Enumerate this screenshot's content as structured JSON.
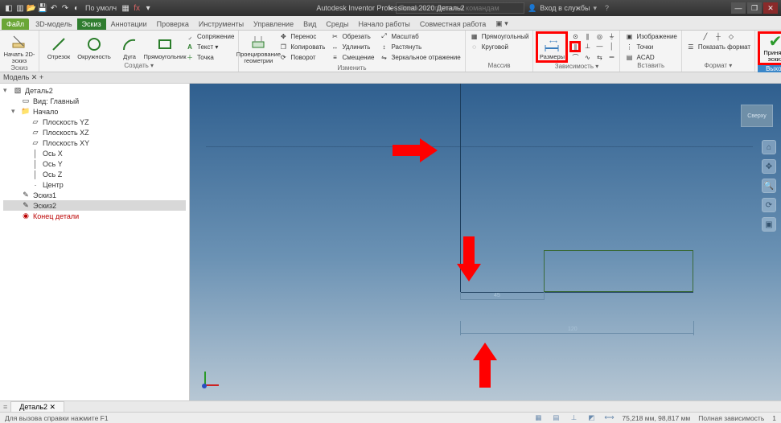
{
  "app": {
    "title_center": "Autodesk Inventor Professional 2020   Деталь2",
    "qat_style_label": "По умолч",
    "search_placeholder": "Поиск по справке и командам",
    "signin_label": "Вход в службы",
    "win_min": "—",
    "win_max": "❐",
    "win_close": "✕"
  },
  "tabs": {
    "file": "Файл",
    "items": [
      "3D-модель",
      "Эскиз",
      "Аннотации",
      "Проверка",
      "Инструменты",
      "Управление",
      "Вид",
      "Среды",
      "Начало работы",
      "Совместная работа"
    ],
    "active_index": 1
  },
  "ribbon": {
    "panels": [
      {
        "title": "Эскиз",
        "big": [
          {
            "name": "start-2d-sketch",
            "label": "Начать\n2D-эскиз",
            "icon": "pencil"
          }
        ]
      },
      {
        "title": "Создать ▾",
        "big": [
          {
            "name": "line",
            "label": "Отрезок",
            "icon": "line"
          },
          {
            "name": "circle",
            "label": "Окружность",
            "icon": "circle"
          },
          {
            "name": "arc",
            "label": "Дуга",
            "icon": "arc"
          },
          {
            "name": "rect",
            "label": "Прямоугольник",
            "icon": "rect"
          }
        ],
        "col": [
          {
            "name": "fillet",
            "label": "Сопряжение",
            "icon": "fillet"
          },
          {
            "name": "text",
            "label": "Текст ▾",
            "icon": "text"
          },
          {
            "name": "point",
            "label": "Точка",
            "icon": "point"
          }
        ]
      },
      {
        "title": "Изменить",
        "big": [
          {
            "name": "project-geometry",
            "label": "Проецирование\nгеометрии",
            "icon": "proj"
          }
        ],
        "cols": [
          [
            {
              "name": "move",
              "label": "Перенос",
              "icon": "move"
            },
            {
              "name": "copy",
              "label": "Копировать",
              "icon": "copy"
            },
            {
              "name": "rotate",
              "label": "Поворот",
              "icon": "rotate"
            }
          ],
          [
            {
              "name": "trim",
              "label": "Обрезать",
              "icon": "trim"
            },
            {
              "name": "extend",
              "label": "Удлинить",
              "icon": "extend"
            },
            {
              "name": "offset",
              "label": "Смещение",
              "icon": "offset"
            }
          ],
          [
            {
              "name": "scale",
              "label": "Масштаб",
              "icon": "scale"
            },
            {
              "name": "stretch",
              "label": "Растянуть",
              "icon": "stretch"
            },
            {
              "name": "mirror",
              "label": "Зеркальное отражение",
              "icon": "mirror"
            }
          ]
        ]
      },
      {
        "title": "Массив",
        "col": [
          {
            "name": "pattern-rect",
            "label": "Прямоугольный",
            "icon": "prect"
          },
          {
            "name": "pattern-circ",
            "label": "Круговой",
            "icon": "pcirc"
          }
        ]
      },
      {
        "title": "Зависимость ▾",
        "big": [
          {
            "name": "dimension",
            "label": "Размеры",
            "icon": "dim",
            "highlight": true
          }
        ],
        "grid": true,
        "grid_hl_index": 4
      },
      {
        "title": "Вставить",
        "col": [
          {
            "name": "image",
            "label": "Изображение",
            "icon": "img"
          },
          {
            "name": "points-import",
            "label": "Точки",
            "icon": "pts"
          },
          {
            "name": "acad",
            "label": "ACAD",
            "icon": "acad"
          }
        ]
      },
      {
        "title": "Формат ▾",
        "big": [
          {
            "name": "show-format",
            "label": "Показать формат",
            "icon": "fmt"
          }
        ]
      },
      {
        "title_special": "Выход",
        "finish": {
          "name": "finish-sketch",
          "label": "Принять\nэскиз",
          "highlight": true
        }
      }
    ]
  },
  "panelbar": {
    "label": "Модель ✕  +"
  },
  "browser": {
    "items": [
      {
        "depth": 0,
        "exp": "▾",
        "icon": "part",
        "label": "Деталь2",
        "sel": false
      },
      {
        "depth": 1,
        "exp": "",
        "icon": "view",
        "label": "Вид: Главный",
        "sel": false
      },
      {
        "depth": 1,
        "exp": "▾",
        "icon": "folder",
        "label": "Начало",
        "sel": false
      },
      {
        "depth": 2,
        "exp": "",
        "icon": "plane",
        "label": "Плоскость YZ",
        "sel": false
      },
      {
        "depth": 2,
        "exp": "",
        "icon": "plane",
        "label": "Плоскость XZ",
        "sel": false
      },
      {
        "depth": 2,
        "exp": "",
        "icon": "plane",
        "label": "Плоскость XY",
        "sel": false
      },
      {
        "depth": 2,
        "exp": "",
        "icon": "axis",
        "label": "Ось X",
        "sel": false
      },
      {
        "depth": 2,
        "exp": "",
        "icon": "axis",
        "label": "Ось Y",
        "sel": false
      },
      {
        "depth": 2,
        "exp": "",
        "icon": "axis",
        "label": "Ось Z",
        "sel": false
      },
      {
        "depth": 2,
        "exp": "",
        "icon": "pt",
        "label": "Центр",
        "sel": false
      },
      {
        "depth": 1,
        "exp": "",
        "icon": "sketch",
        "label": "Эскиз1",
        "sel": false
      },
      {
        "depth": 1,
        "exp": "",
        "icon": "sketch",
        "label": "Эскиз2",
        "sel": true
      },
      {
        "depth": 1,
        "exp": "",
        "icon": "end",
        "label": "Конец детали",
        "sel": false,
        "end": true
      }
    ]
  },
  "canvas": {
    "viewcube": "Сверху",
    "dim1_text": "45",
    "dim2_text": "120"
  },
  "doctabs": {
    "tab1": "Деталь2  ✕"
  },
  "status": {
    "left": "Для вызовa справки нажмите F1",
    "coords": "75,218 мм, 98,817 мм",
    "constraints": "Полная зависимость",
    "count": "1"
  },
  "chart_data": {
    "type": "table",
    "note": "no chart in image"
  }
}
